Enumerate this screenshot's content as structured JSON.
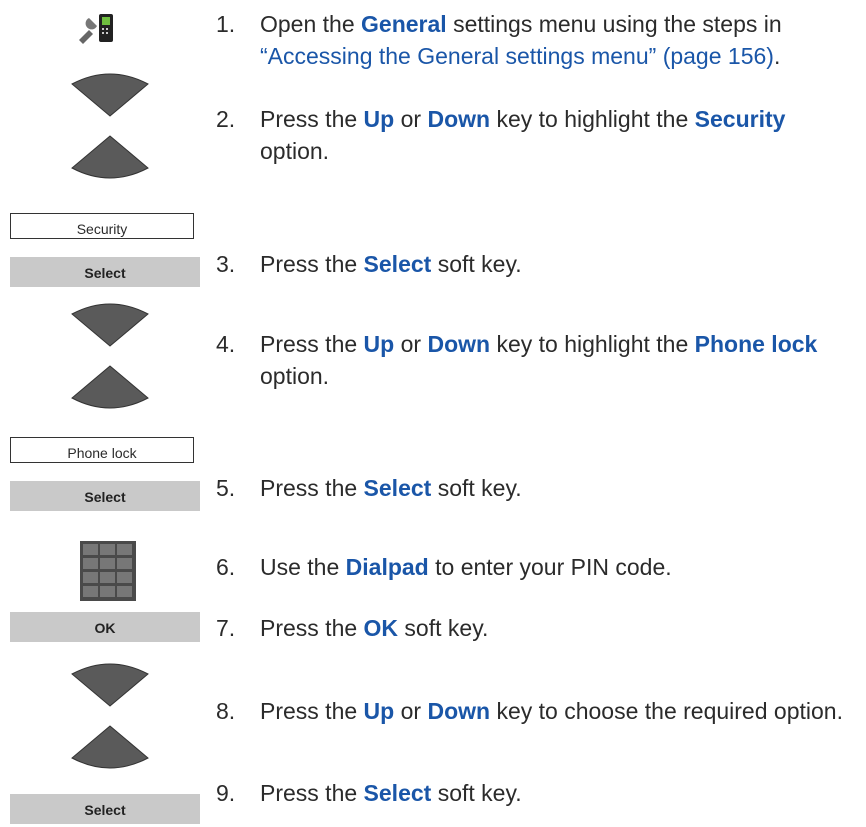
{
  "steps": [
    {
      "num": "1.",
      "parts": [
        {
          "t": "Open the ",
          "s": ""
        },
        {
          "t": "General",
          "s": "kw"
        },
        {
          "t": " settings menu using the steps in ",
          "s": ""
        },
        {
          "t": "“Accessing the General settings menu” (page 156)",
          "s": "ref"
        },
        {
          "t": ".",
          "s": ""
        }
      ]
    },
    {
      "num": "2.",
      "parts": [
        {
          "t": "Press the ",
          "s": ""
        },
        {
          "t": "Up",
          "s": "kw"
        },
        {
          "t": " or ",
          "s": ""
        },
        {
          "t": "Down",
          "s": "kw"
        },
        {
          "t": " key to highlight the ",
          "s": ""
        },
        {
          "t": "Security",
          "s": "kw"
        },
        {
          "t": " option.",
          "s": ""
        }
      ]
    },
    {
      "num": "3.",
      "parts": [
        {
          "t": "Press the ",
          "s": ""
        },
        {
          "t": "Select",
          "s": "kw"
        },
        {
          "t": " soft key.",
          "s": ""
        }
      ]
    },
    {
      "num": "4.",
      "parts": [
        {
          "t": "Press the ",
          "s": ""
        },
        {
          "t": "Up",
          "s": "kw"
        },
        {
          "t": " or ",
          "s": ""
        },
        {
          "t": "Down",
          "s": "kw"
        },
        {
          "t": " key to highlight the ",
          "s": ""
        },
        {
          "t": "Phone lock",
          "s": "kw"
        },
        {
          "t": " option.",
          "s": ""
        }
      ]
    },
    {
      "num": "5.",
      "parts": [
        {
          "t": "Press the ",
          "s": ""
        },
        {
          "t": "Select",
          "s": "kw"
        },
        {
          "t": " soft key.",
          "s": ""
        }
      ]
    },
    {
      "num": "6.",
      "parts": [
        {
          "t": "Use the ",
          "s": ""
        },
        {
          "t": "Dialpad",
          "s": "kw"
        },
        {
          "t": " to enter your PIN code.",
          "s": ""
        }
      ]
    },
    {
      "num": "7.",
      "parts": [
        {
          "t": "Press the ",
          "s": ""
        },
        {
          "t": "OK",
          "s": "kw"
        },
        {
          "t": " soft key.",
          "s": ""
        }
      ]
    },
    {
      "num": "8.",
      "parts": [
        {
          "t": "Press the ",
          "s": ""
        },
        {
          "t": "Up",
          "s": "kw"
        },
        {
          "t": " or ",
          "s": ""
        },
        {
          "t": "Down",
          "s": "kw"
        },
        {
          "t": " key to choose the required option.",
          "s": ""
        }
      ]
    },
    {
      "num": "9.",
      "parts": [
        {
          "t": "Press the ",
          "s": ""
        },
        {
          "t": "Select",
          "s": "kw"
        },
        {
          "t": " soft key.",
          "s": ""
        }
      ]
    }
  ],
  "screens": {
    "security": "Security",
    "phone_lock": "Phone lock"
  },
  "softkeys": {
    "select": "Select",
    "ok": "OK"
  },
  "icons": {
    "settings": "settings-phone-icon",
    "nav": "up-down-navigation-key-icon",
    "dialpad": "dialpad-icon"
  },
  "colors": {
    "keyword": "#1a56a8",
    "softkey_bg": "#c9c9c9",
    "nav_key": "#555555"
  }
}
